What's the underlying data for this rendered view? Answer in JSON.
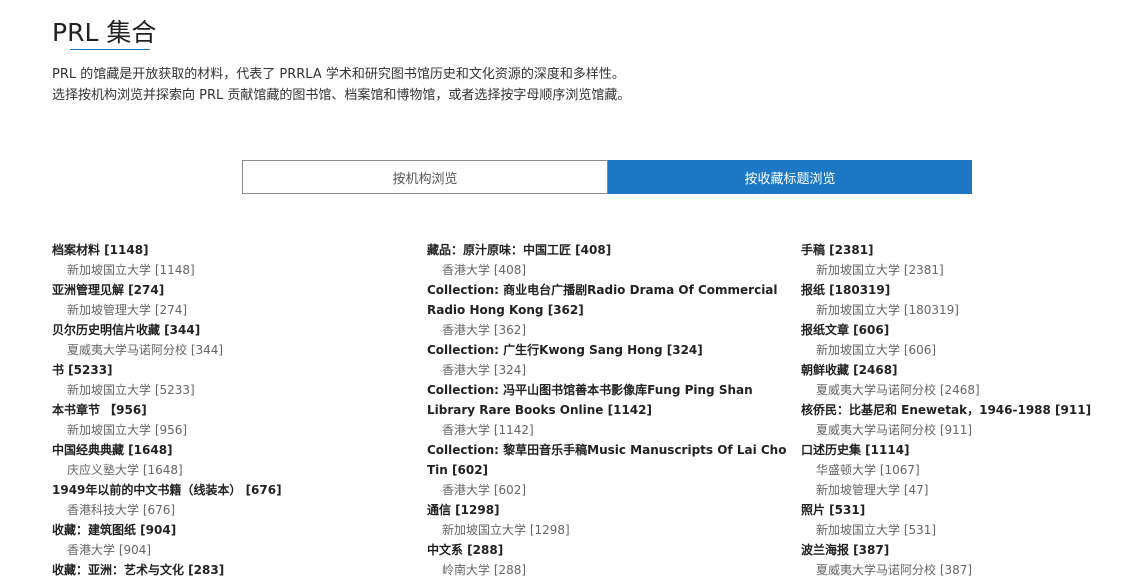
{
  "header": {
    "title": "PRL 集合",
    "intro_line1": "PRL 的馆藏是开放获取的材料，代表了 PRRLA 学术和研究图书馆历史和文化资源的深度和多样性。",
    "intro_line2": "选择按机构浏览并探索向 PRL 贡献馆藏的图书馆、档案馆和博物馆，或者选择按字母顺序浏览馆藏。"
  },
  "tabs": {
    "by_institution": "按机构浏览",
    "by_collection": "按收藏标题浏览"
  },
  "columns": [
    [
      {
        "name": "档案材料 [1148]",
        "institutions": [
          "新加坡国立大学 [1148]"
        ]
      },
      {
        "name": "亚洲管理见解 [274]",
        "institutions": [
          "新加坡管理大学 [274]"
        ]
      },
      {
        "name": "贝尔历史明信片收藏 [344]",
        "institutions": [
          "夏威夷大学马诺阿分校 [344]"
        ]
      },
      {
        "name": "书 [5233]",
        "institutions": [
          "新加坡国立大学 [5233]"
        ]
      },
      {
        "name": "本书章节 【956]",
        "institutions": [
          "新加坡国立大学 [956]"
        ]
      },
      {
        "name": "中国经典典藏 [1648]",
        "institutions": [
          "庆应义塾大学 [1648]"
        ]
      },
      {
        "name": "1949年以前的中文书籍（线装本） [676]",
        "institutions": [
          "香港科技大学 [676]"
        ]
      },
      {
        "name": "收藏：建筑图纸 [904]",
        "institutions": [
          "香港大学 [904]"
        ]
      },
      {
        "name": "收藏：亚洲：艺术与文化 [283]",
        "institutions": []
      }
    ],
    [
      {
        "name": "藏品：原汁原味：中国工匠 [408]",
        "institutions": [
          "香港大学 [408]"
        ]
      },
      {
        "name": "Collection: 商业电台广播剧Radio Drama Of Commercial Radio Hong Kong [362]",
        "institutions": [
          "香港大学 [362]"
        ]
      },
      {
        "name": "Collection: 广生行Kwong Sang Hong [324]",
        "institutions": [
          "香港大学 [324]"
        ]
      },
      {
        "name": "Collection: 冯平山图书馆善本书影像库Fung Ping Shan Library Rare Books Online [1142]",
        "institutions": [
          "香港大学 [1142]"
        ]
      },
      {
        "name": "Collection: 黎草田音乐手稿Music Manuscripts Of Lai Cho Tin [602]",
        "institutions": [
          "香港大学 [602]"
        ]
      },
      {
        "name": "通信 [1298]",
        "institutions": [
          "新加坡国立大学 [1298]"
        ]
      },
      {
        "name": "中文系 [288]",
        "institutions": [
          "岭南大学 [288]"
        ]
      }
    ],
    [
      {
        "name": "手稿 [2381]",
        "institutions": [
          "新加坡国立大学 [2381]"
        ]
      },
      {
        "name": "报纸 [180319]",
        "institutions": [
          "新加坡国立大学 [180319]"
        ]
      },
      {
        "name": "报纸文章 [606]",
        "institutions": [
          "新加坡国立大学 [606]"
        ]
      },
      {
        "name": "朝鲜收藏 [2468]",
        "institutions": [
          "夏威夷大学马诺阿分校 [2468]"
        ]
      },
      {
        "name": "核侨民：比基尼和 Enewetak，1946-1988 [911]",
        "institutions": [
          "夏威夷大学马诺阿分校 [911]"
        ]
      },
      {
        "name": "口述历史集 [1114]",
        "institutions": [
          "华盛顿大学 [1067]",
          "新加坡管理大学 [47]"
        ]
      },
      {
        "name": "照片 [531]",
        "institutions": [
          "新加坡国立大学 [531]"
        ]
      },
      {
        "name": "波兰海报 [387]",
        "institutions": [
          "夏威夷大学马诺阿分校 [387]"
        ]
      }
    ]
  ]
}
